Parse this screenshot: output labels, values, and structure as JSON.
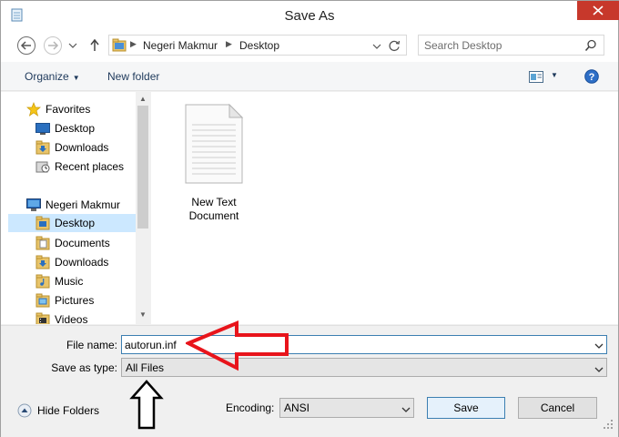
{
  "window": {
    "title": "Save As",
    "close_icon": "close-icon"
  },
  "nav": {
    "back_icon": "back-arrow-icon",
    "forward_icon": "forward-arrow-icon",
    "up_icon": "up-arrow-icon",
    "breadcrumb": [
      "Negeri Makmur",
      "Desktop"
    ],
    "refresh_icon": "refresh-icon"
  },
  "search": {
    "placeholder": "Search Desktop"
  },
  "toolbar": {
    "organize_label": "Organize",
    "new_folder_label": "New folder"
  },
  "sidebar": {
    "favorites": {
      "label": "Favorites",
      "items": [
        {
          "label": "Desktop",
          "icon": "desktop-icon"
        },
        {
          "label": "Downloads",
          "icon": "downloads-folder-icon"
        },
        {
          "label": "Recent places",
          "icon": "recent-places-icon"
        }
      ]
    },
    "computer": {
      "label": "Negeri Makmur",
      "items": [
        {
          "label": "Desktop",
          "icon": "desktop-folder-icon",
          "selected": true
        },
        {
          "label": "Documents",
          "icon": "documents-folder-icon"
        },
        {
          "label": "Downloads",
          "icon": "downloads-folder-icon"
        },
        {
          "label": "Music",
          "icon": "music-folder-icon"
        },
        {
          "label": "Pictures",
          "icon": "pictures-folder-icon"
        },
        {
          "label": "Videos",
          "icon": "videos-folder-icon"
        }
      ]
    }
  },
  "files": [
    {
      "name": "New Text Document",
      "line1": "New Text",
      "line2": "Document",
      "icon": "text-document-icon"
    }
  ],
  "form": {
    "file_name_label": "File name:",
    "file_name_value": "autorun.inf",
    "save_as_type_label": "Save as type:",
    "save_as_type_value": "All Files",
    "encoding_label": "Encoding:",
    "encoding_value": "ANSI",
    "hide_folders_label": "Hide Folders",
    "save_label": "Save",
    "cancel_label": "Cancel"
  },
  "colors": {
    "annotation_red": "#e8141b",
    "annotation_black": "#000000",
    "close_red": "#c7382b",
    "selection_blue": "#cce8ff"
  }
}
